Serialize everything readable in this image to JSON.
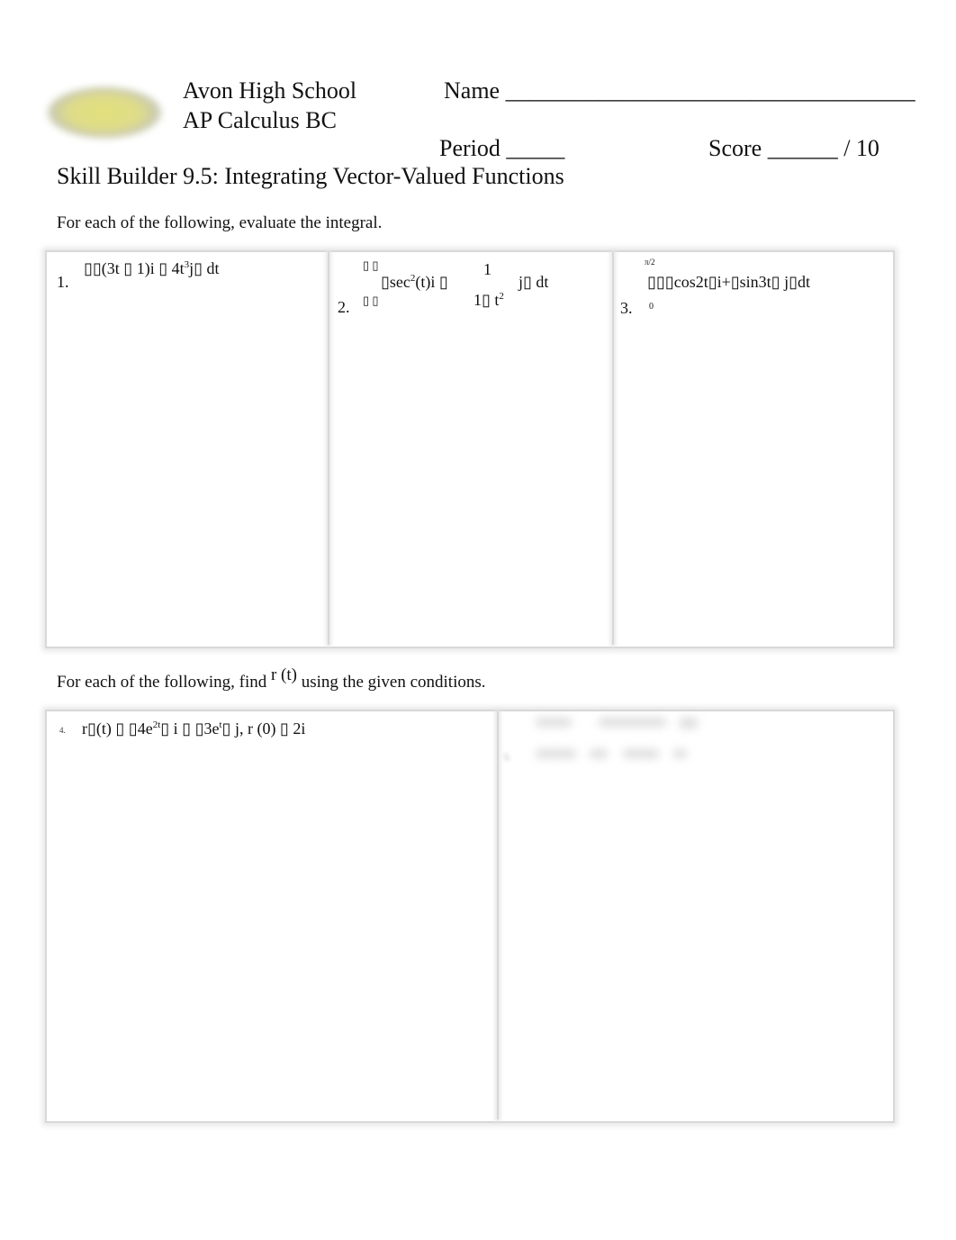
{
  "header": {
    "school": "Avon High School",
    "course": "AP Calculus BC",
    "name_label": "Name ___________________________________",
    "period_label": "Period _____",
    "score_label": "Score ______ / 10",
    "title": "Skill Builder 9.5: Integrating Vector-Valued Functions"
  },
  "section1": {
    "instruction": "For each of the following, evaluate the integral.",
    "problems": [
      {
        "number": "1.",
        "expr": "▯▯(3t ▯ 1)i ▯ 4t",
        "sup": "3",
        "rest": "j▯ dt"
      },
      {
        "number": "2.",
        "lead": "▯sec",
        "sup": "2",
        "mid": "(t)i ▯",
        "num": "1",
        "den": "1▯ t",
        "densup": "2",
        "rest": "j▯ dt",
        "brackets": "▯ ▯"
      },
      {
        "number": "3.",
        "expr": "▯▯▯cos2t▯i+▯sin3t▯ j▯dt",
        "upper": "π/2",
        "lower": "0"
      }
    ]
  },
  "section2": {
    "instruction_pre": "For each of the following, find",
    "instruction_fn": "r (t)",
    "instruction_post": "using the given conditions.",
    "problems": [
      {
        "number": "4.",
        "expr": "r▯(t) ▯ ▯4e",
        "sup": "2t",
        "mid": "▯ i ▯ ▯3e",
        "sup2": "t",
        "rest": "▯ j,  r (0) ▯ 2i"
      },
      {
        "number": "5."
      }
    ]
  }
}
